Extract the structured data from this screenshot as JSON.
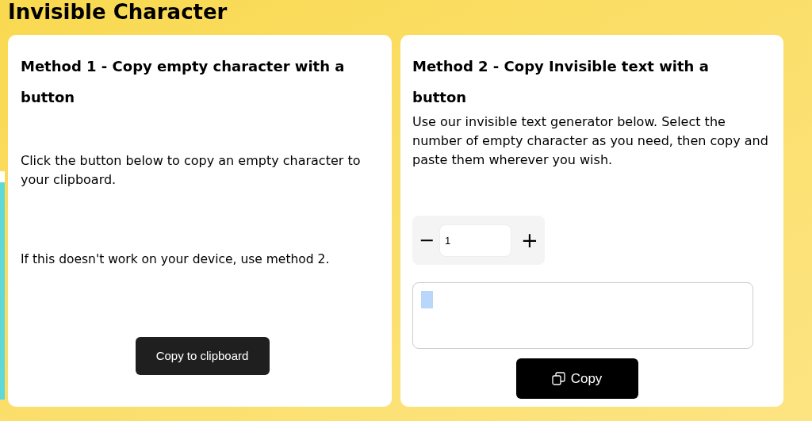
{
  "title": "Invisible Character",
  "method1": {
    "heading": "Method 1 - Copy empty character with a button",
    "paragraphs": [
      "Click the button below to copy an empty character to your clipboard.",
      "If this doesn't work on your device, use method 2."
    ],
    "button": "Copy to clipboard"
  },
  "method2": {
    "heading": "Method 2 - Copy Invisible text with a button",
    "description": "Use our invisible text generator below. Select the number of empty character as you need, then copy and paste them wherever you wish.",
    "stepper": {
      "minus": "−",
      "value": "1",
      "plus": "+"
    },
    "output": {
      "selected": true
    },
    "button": "Copy"
  }
}
